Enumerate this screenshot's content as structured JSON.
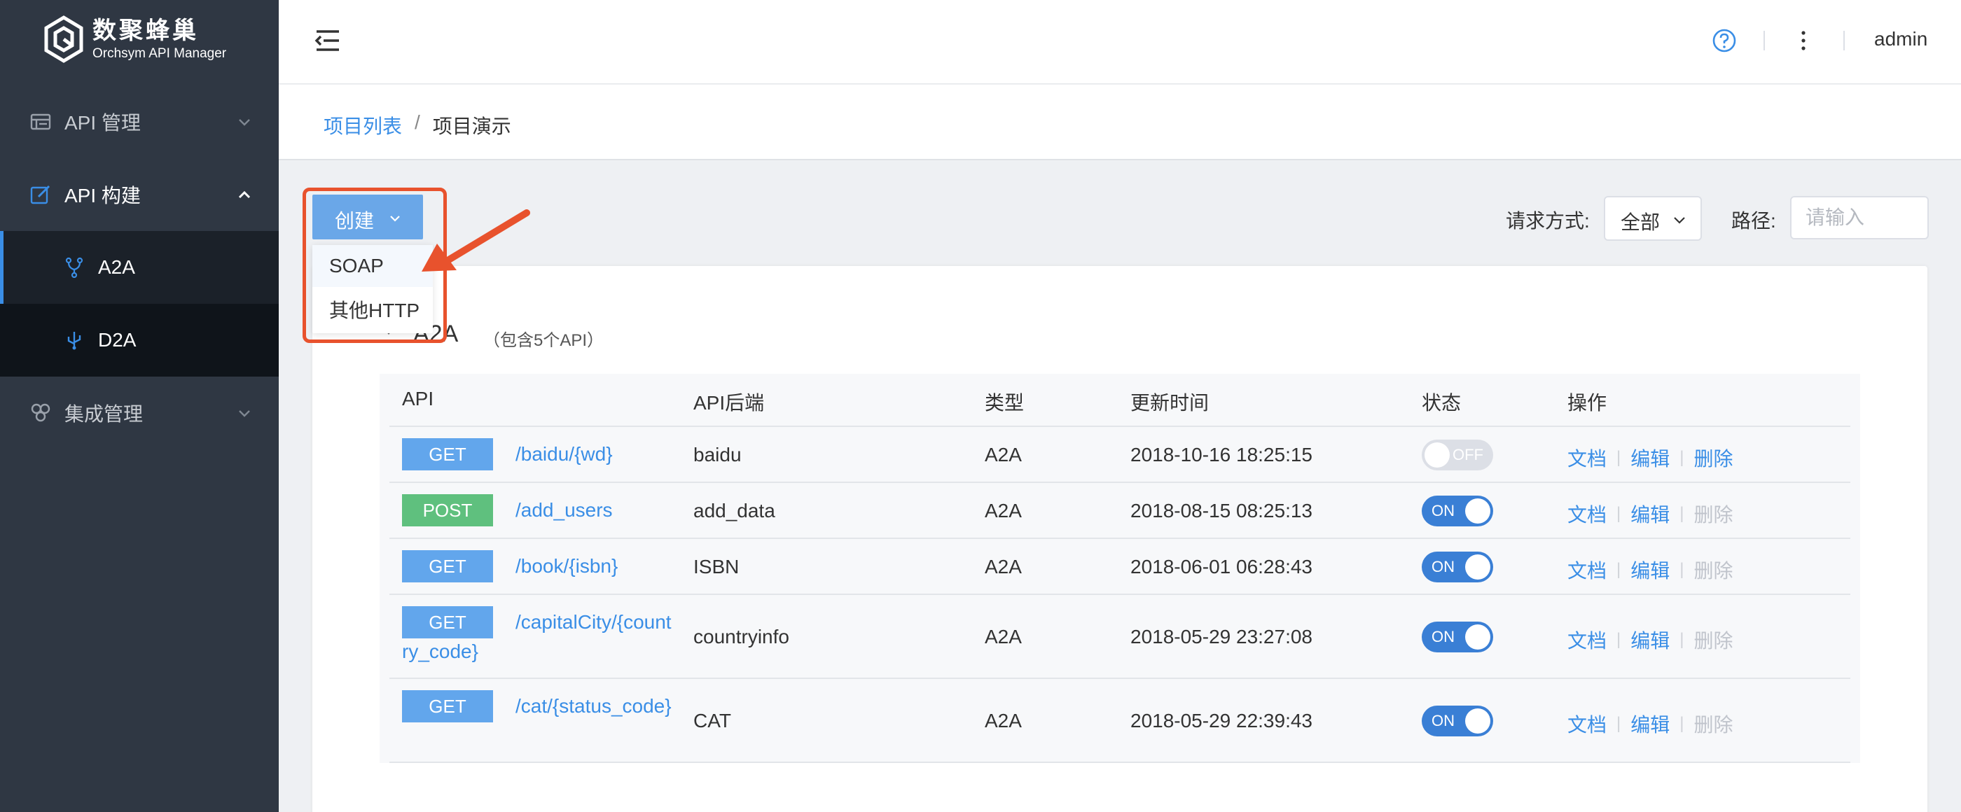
{
  "brand": {
    "title": "数聚蜂巢",
    "subtitle": "Orchsym API Manager"
  },
  "sidebar": {
    "items": [
      {
        "label": "API 管理",
        "icon": "list-icon",
        "expanded": false
      },
      {
        "label": "API 构建",
        "icon": "edit-icon",
        "expanded": true
      },
      {
        "label": "集成管理",
        "icon": "integration-icon",
        "expanded": false
      }
    ],
    "subitems": [
      {
        "label": "A2A",
        "icon": "branch-icon",
        "active": true
      },
      {
        "label": "D2A",
        "icon": "usb-icon",
        "active": false
      }
    ]
  },
  "header": {
    "user": "admin",
    "icons": [
      "menu-fold-icon",
      "help-icon",
      "more-vertical-icon"
    ]
  },
  "breadcrumb": {
    "parent": "项目列表",
    "separator": "/",
    "current": "项目演示"
  },
  "toolbar": {
    "create_label": "创建",
    "create_menu": [
      "SOAP",
      "其他HTTP"
    ],
    "method_label": "请求方式:",
    "method_value": "全部",
    "path_label": "路径:",
    "path_placeholder": "请输入"
  },
  "group": {
    "title": "A2A",
    "note": "（包含5个API）"
  },
  "table": {
    "headers": [
      "API",
      "API后端",
      "类型",
      "更新时间",
      "状态",
      "操作"
    ],
    "actions": {
      "doc": "文档",
      "edit": "编辑",
      "delete": "删除"
    },
    "rows": [
      {
        "method": "GET",
        "path": "/baidu/{wd}",
        "backend": "baidu",
        "type": "A2A",
        "updated": "2018-10-16 18:25:15",
        "status": "OFF",
        "delete_enabled": true
      },
      {
        "method": "POST",
        "path": "/add_users",
        "backend": "add_data",
        "type": "A2A",
        "updated": "2018-08-15 08:25:13",
        "status": "ON",
        "delete_enabled": false
      },
      {
        "method": "GET",
        "path": "/book/{isbn}",
        "backend": "ISBN",
        "type": "A2A",
        "updated": "2018-06-01 06:28:43",
        "status": "ON",
        "delete_enabled": false
      },
      {
        "method": "GET",
        "path": "/capitalCity/{country_code}",
        "backend": "countryinfo",
        "type": "A2A",
        "updated": "2018-05-29 23:27:08",
        "status": "ON",
        "delete_enabled": false
      },
      {
        "method": "GET",
        "path": "/cat/{status_code}",
        "backend": "CAT",
        "type": "A2A",
        "updated": "2018-05-29 22:39:43",
        "status": "ON",
        "delete_enabled": false
      }
    ]
  },
  "colors": {
    "accent": "#3a8ee6",
    "sidebar_bg": "#2f3743",
    "highlight": "#e8522d",
    "get": "#62a6ec",
    "post": "#5fc07e"
  }
}
